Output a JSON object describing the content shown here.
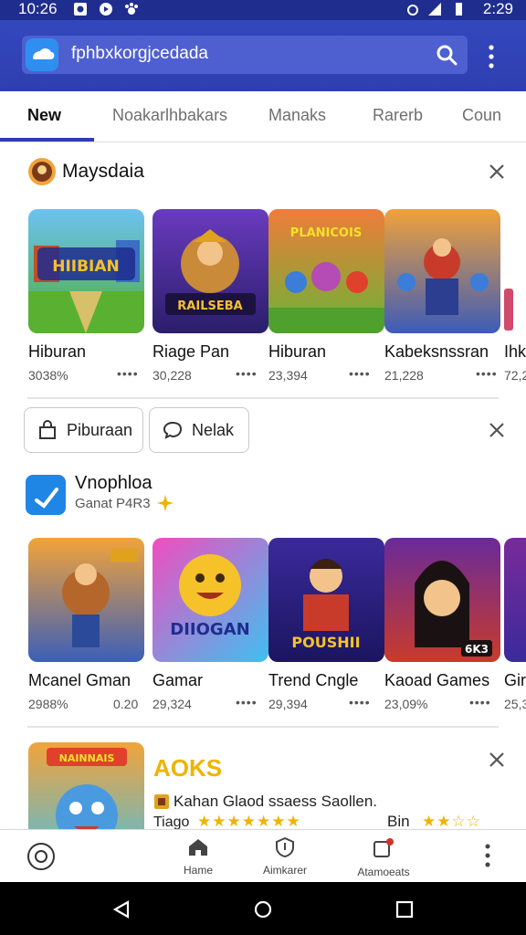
{
  "status_bar": {
    "time": "10:26",
    "clock_right": "2:29"
  },
  "search": {
    "text": "fphbxkorgjcedada"
  },
  "tabs": [
    {
      "label": "New"
    },
    {
      "label": "Noakarlhbakars"
    },
    {
      "label": "Manaks"
    },
    {
      "label": "Rarerb"
    },
    {
      "label": "Coun"
    }
  ],
  "section1": {
    "title": "Maysdaia",
    "items": [
      {
        "name": "Hiburan",
        "stat": "3038%",
        "art": "HIIBIAN"
      },
      {
        "name": "Riage Pan",
        "stat": "30,228",
        "art": "RAILSEBA"
      },
      {
        "name": "Hiburan",
        "stat": "23,394",
        "art": "PLANICOIS"
      },
      {
        "name": "Kabeksnssran",
        "stat": "21,228",
        "art": ""
      },
      {
        "name": "Ihk",
        "stat": "72,2"
      }
    ]
  },
  "chips": [
    {
      "label": "Piburaan"
    },
    {
      "label": "Nelak"
    }
  ],
  "section2": {
    "app_name": "Vnophloa",
    "subtitle": "Ganat P4R3",
    "items": [
      {
        "name": "Mcanel Gman",
        "stat": "2988%",
        "stat2": "0.20",
        "art": ""
      },
      {
        "name": "Gamar",
        "stat": "29,324",
        "art": "DIIOGAN"
      },
      {
        "name": "Trend Cngle",
        "stat": "29,394",
        "art": "POUSHII"
      },
      {
        "name": "Kaoad Games",
        "stat": "23,09%",
        "art": "6K3"
      },
      {
        "name": "Gir",
        "stat": "25,3"
      }
    ]
  },
  "section3": {
    "title": "AOKS",
    "line1": "Kahan Glaod ssaess  Saollen.",
    "line2_prefix": "Tiago",
    "line2_suffix": "Bin",
    "art": "NAINNAIS"
  },
  "bottom_nav": [
    {
      "label": "Hame"
    },
    {
      "label": "Aimkarer"
    },
    {
      "label": "Atamoeats"
    }
  ],
  "colors": {
    "primary": "#2d3fb0",
    "accent": "#f0b400"
  }
}
